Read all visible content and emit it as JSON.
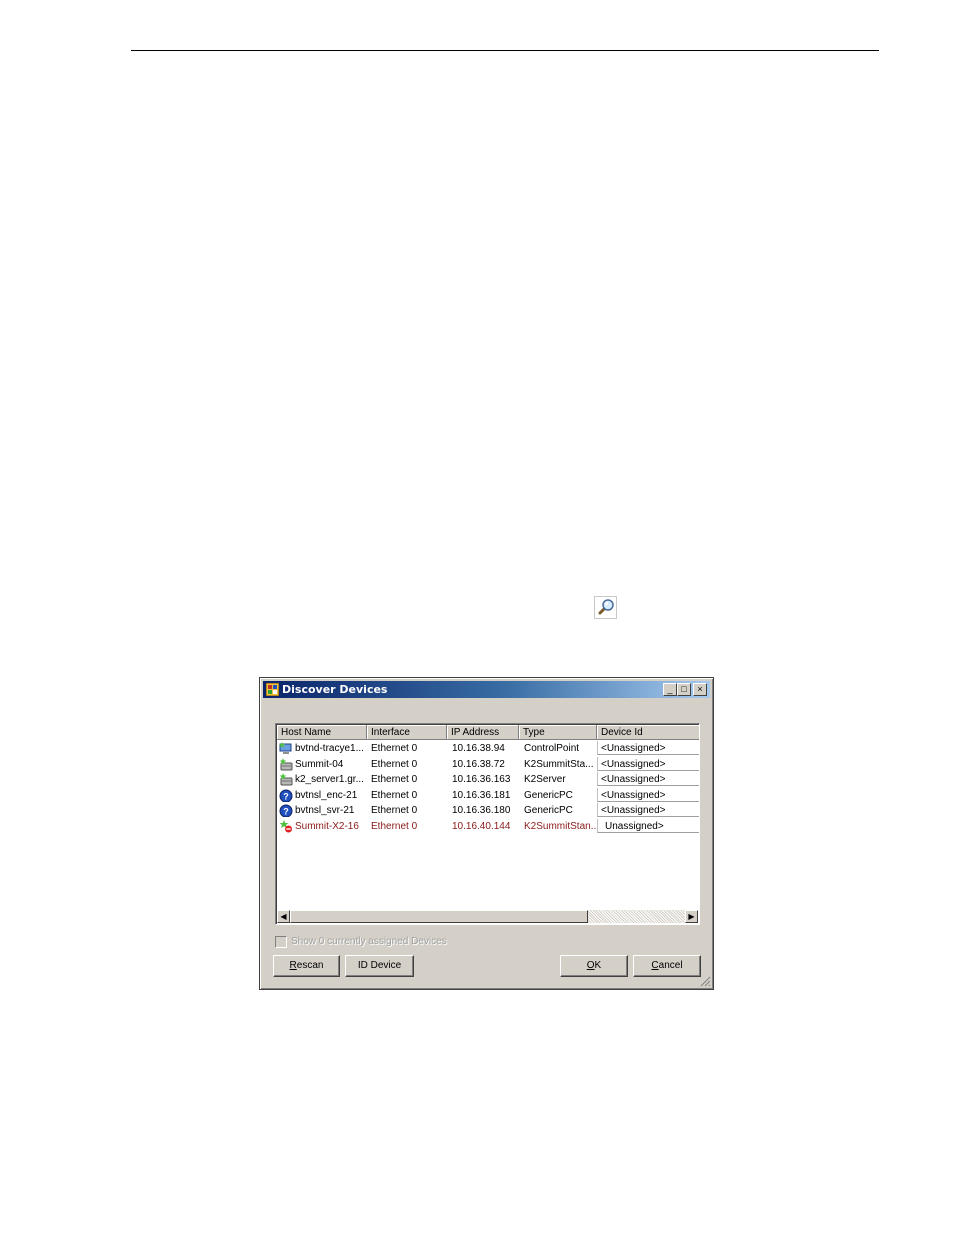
{
  "dialog": {
    "title": "Discover Devices",
    "buttons_titlebar": {
      "minimize": "_",
      "maximize": "□",
      "close": "×"
    },
    "columns": [
      "Host Name",
      "Interface",
      "IP Address",
      "Type",
      "Device Id"
    ],
    "rows": [
      {
        "host": "bvtnd-tracye1...",
        "interface": "Ethernet 0",
        "ip": "10.16.38.94",
        "type": "ControlPoint",
        "device_id": "<Unassigned>",
        "icon": "computer-star-icon"
      },
      {
        "host": "Summit-04",
        "interface": "Ethernet 0",
        "ip": "10.16.38.72",
        "type": "K2SummitSta...",
        "device_id": "<Unassigned>",
        "icon": "server-star-icon"
      },
      {
        "host": "k2_server1.gr...",
        "interface": "Ethernet 0",
        "ip": "10.16.36.163",
        "type": "K2Server",
        "device_id": "<Unassigned>",
        "icon": "server-star-icon"
      },
      {
        "host": "bvtnsl_enc-21",
        "interface": "Ethernet 0",
        "ip": "10.16.36.181",
        "type": "GenericPC",
        "device_id": "<Unassigned>",
        "icon": "question-icon"
      },
      {
        "host": "bvtnsl_svr-21",
        "interface": "Ethernet 0",
        "ip": "10.16.36.180",
        "type": "GenericPC",
        "device_id": "<Unassigned>",
        "icon": "question-icon"
      },
      {
        "host": "Summit-X2-16",
        "interface": "Ethernet 0",
        "ip": "10.16.40.144",
        "type": "K2SummitStan...",
        "device_id": "Unassigned>",
        "icon": "star-blocked-icon"
      }
    ],
    "checkbox_label": "Show 0 currently assigned Devices",
    "rescan_first": "R",
    "rescan_rest": "escan",
    "id_device": "ID Device",
    "ok_first": "O",
    "ok_rest": "K",
    "cancel_first": "C",
    "cancel_rest": "ancel"
  }
}
